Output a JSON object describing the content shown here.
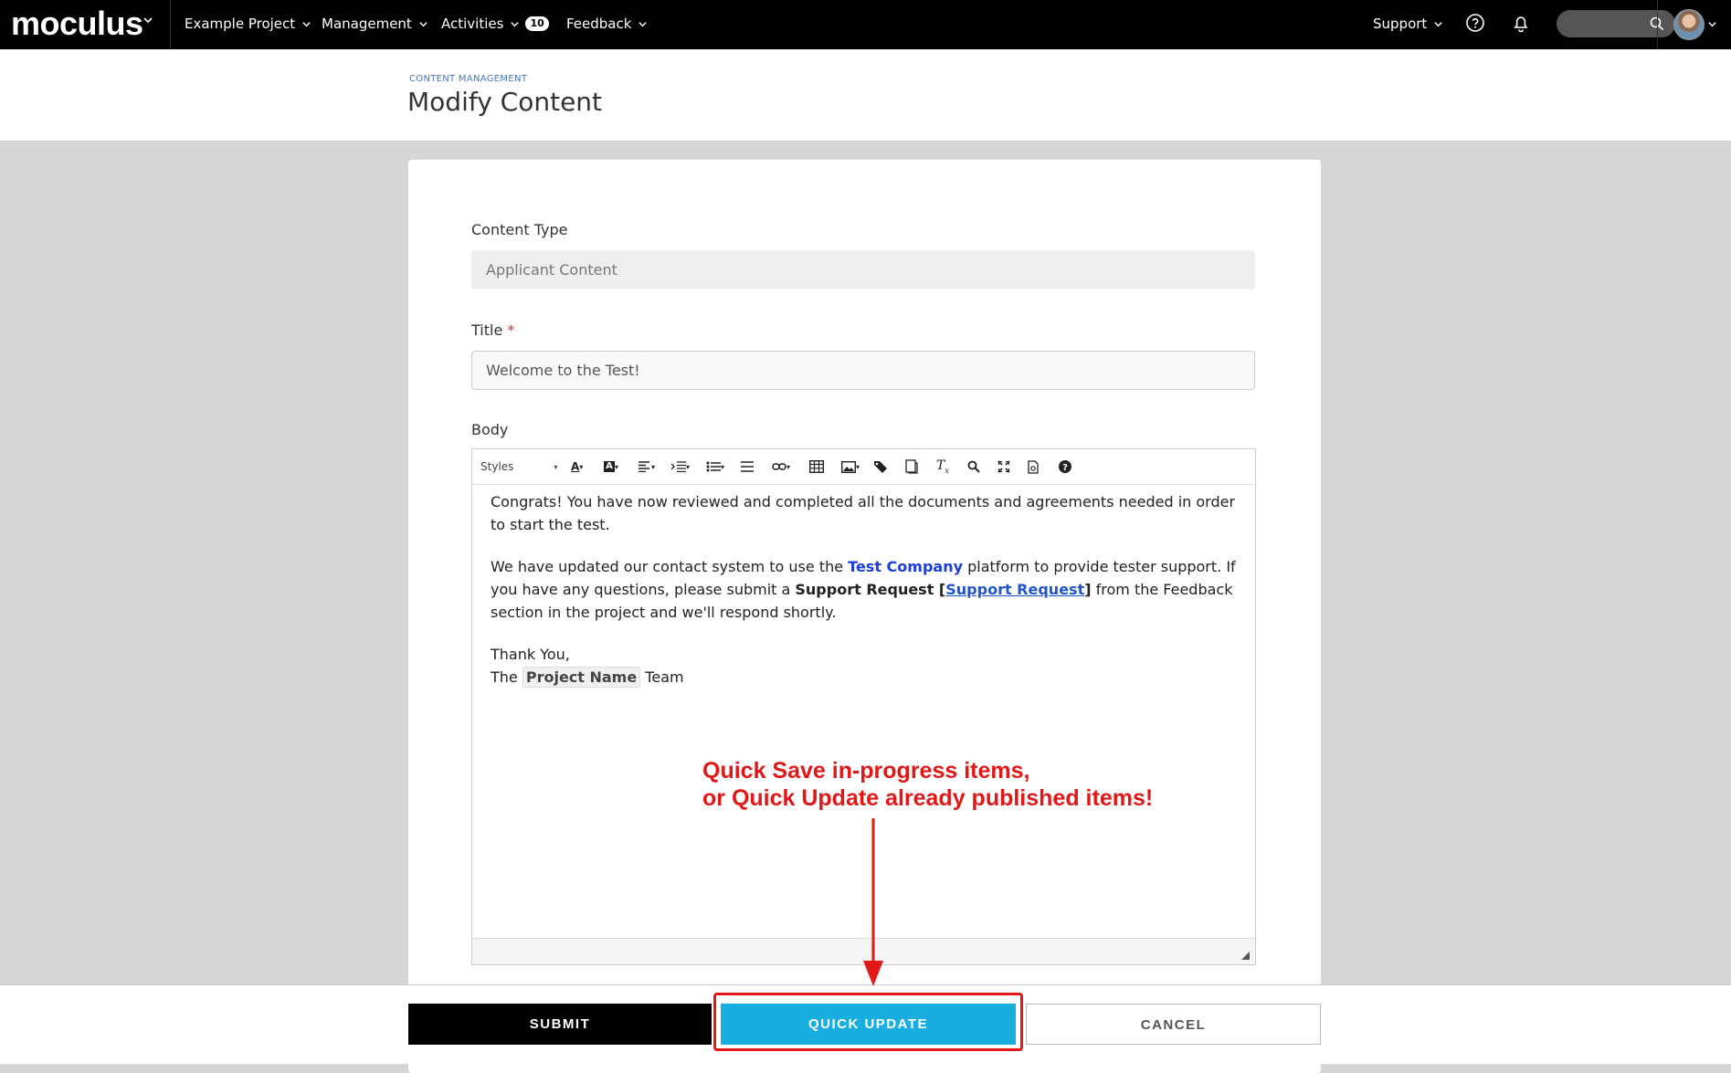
{
  "nav": {
    "logo": "moculus",
    "items": [
      {
        "label": "Example Project"
      },
      {
        "label": "Management"
      },
      {
        "label": "Activities",
        "badge": "10"
      },
      {
        "label": "Feedback"
      }
    ],
    "support_label": "Support"
  },
  "header": {
    "breadcrumb": "CONTENT MANAGEMENT",
    "title": "Modify Content"
  },
  "form": {
    "content_type": {
      "label": "Content Type",
      "value": "Applicant Content"
    },
    "title": {
      "label": "Title",
      "required_mark": "*",
      "value": "Welcome to the Test!"
    },
    "body": {
      "label": "Body",
      "toolbar": {
        "styles_label": "Styles"
      },
      "content": {
        "p1": "Congrats! You have now reviewed and completed all the documents and agreements needed in order to start the test.",
        "p2_a": "We have updated our contact system to use the ",
        "p2_company": "Test Company",
        "p2_b": " platform to provide tester support.  If you have any questions, please submit a ",
        "p2_bold": "Support Request",
        "p2_bracket_open": " [",
        "p2_link": "Support Request",
        "p2_bracket_close": "]",
        "p2_c": " from the Feedback section in the project and we'll respond shortly.",
        "p3_line1": "Thank You,",
        "p3_the": "The ",
        "p3_token": "Project Name",
        "p3_team": " Team"
      }
    }
  },
  "footer": {
    "submit_label": "SUBMIT",
    "quick_update_label": "QUICK UPDATE",
    "cancel_label": "CANCEL"
  },
  "annotation": {
    "line1": "Quick Save in-progress items,",
    "line2": "or Quick Update already published items!",
    "color": "#e01818"
  }
}
